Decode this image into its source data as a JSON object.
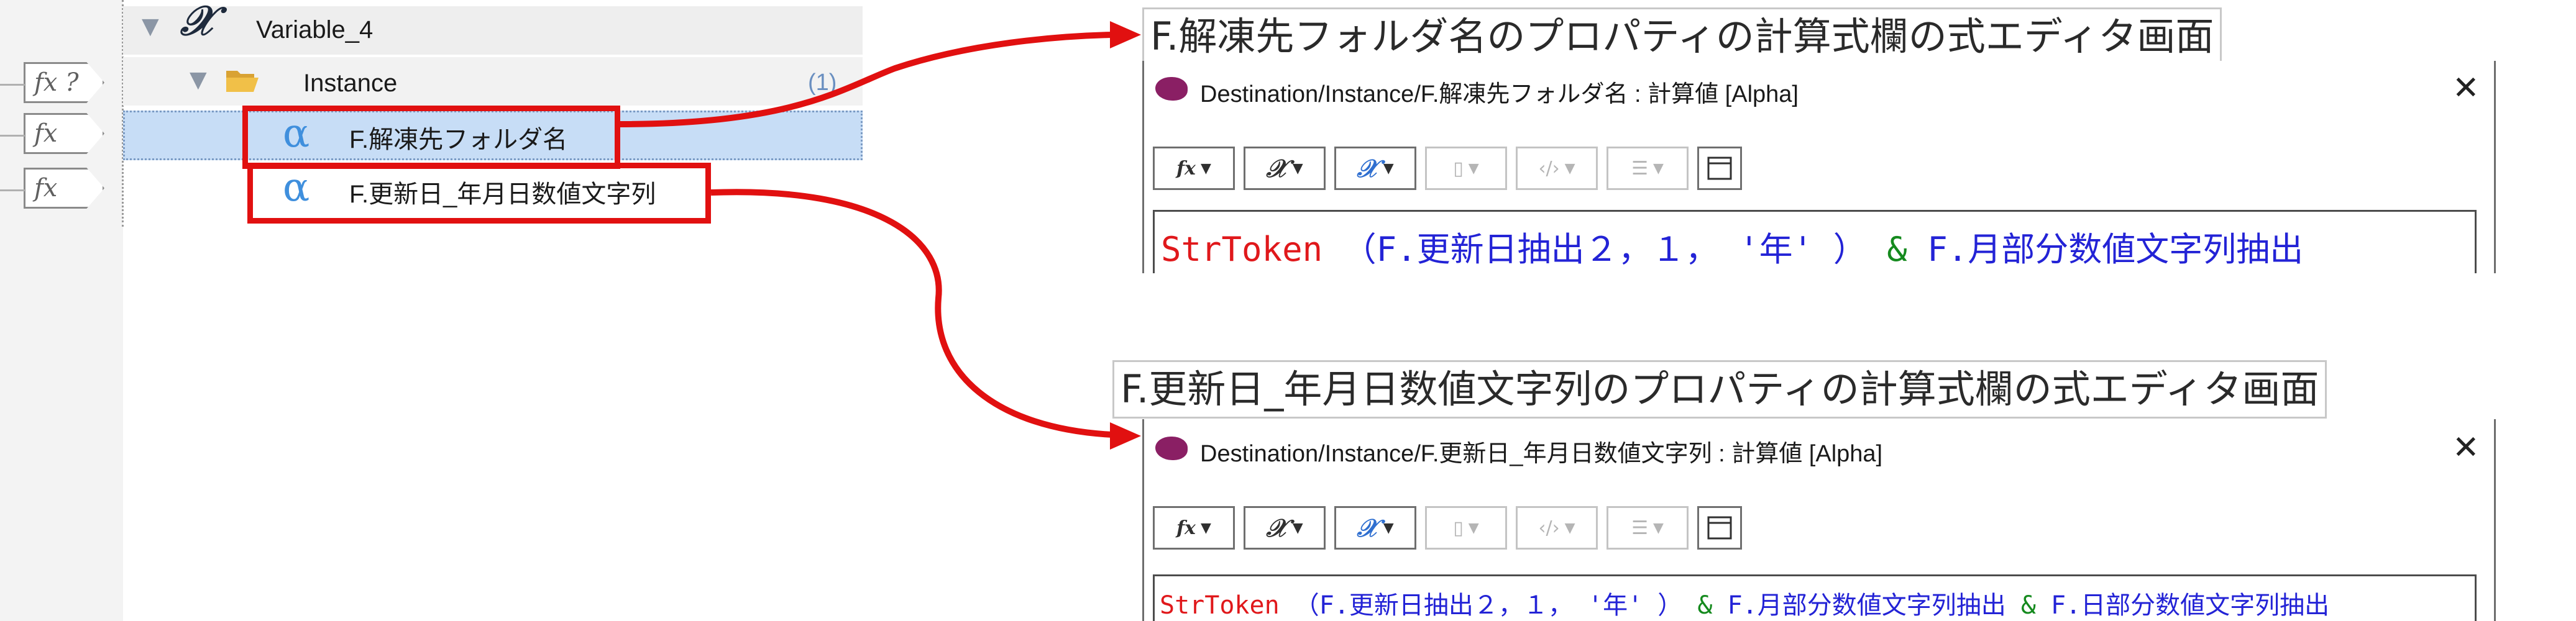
{
  "tree": {
    "fx_tags": [
      {
        "label": "fx ?"
      },
      {
        "label": "fx"
      },
      {
        "label": "fx"
      }
    ],
    "variable": {
      "label": "Variable_4"
    },
    "instance": {
      "label": "Instance",
      "count": "(1)"
    },
    "items": [
      {
        "label": "F.解凍先フォルダ名",
        "selected": true
      },
      {
        "label": "F.更新日_年月日数値文字列",
        "selected": false
      }
    ]
  },
  "captions": {
    "top": "F.解凍先フォルダ名のプロパティの計算式欄の式エディタ画面",
    "bottom": "F.更新日_年月日数値文字列のプロパティの計算式欄の式エディタ画面"
  },
  "editors": [
    {
      "title": "Destination/Instance/F.解凍先フォルダ名 : 計算値 [Alpha]",
      "close": "✕",
      "expression": [
        {
          "text": "StrToken",
          "color": "red"
        },
        {
          "text": "（F.更新日抽出２，１，",
          "color": "blue"
        },
        {
          "text": "'年'",
          "color": "blue"
        },
        {
          "text": "）",
          "color": "blue"
        },
        {
          "text": "&",
          "color": "green"
        },
        {
          "text": "F.月部分数値文字列抽出",
          "color": "blue"
        }
      ]
    },
    {
      "title": "Destination/Instance/F.更新日_年月日数値文字列 : 計算値 [Alpha]",
      "close": "✕",
      "expression": [
        {
          "text": "StrToken",
          "color": "red"
        },
        {
          "text": "（F.更新日抽出２，１，",
          "color": "blue"
        },
        {
          "text": "'年'",
          "color": "blue"
        },
        {
          "text": "）",
          "color": "blue"
        },
        {
          "text": "&",
          "color": "green"
        },
        {
          "text": "F.月部分数値文字列抽出",
          "color": "blue"
        },
        {
          "text": "&",
          "color": "green"
        },
        {
          "text": "F.日部分数値文字列抽出",
          "color": "blue"
        }
      ]
    }
  ],
  "toolbar": [
    {
      "name": "function-button",
      "glyph": "fx",
      "enabled": true
    },
    {
      "name": "variable-button",
      "glyph": "𝒳",
      "enabled": true
    },
    {
      "name": "field-button",
      "glyph": "𝒳ₓ",
      "enabled": true
    },
    {
      "name": "clipboard-button",
      "glyph": "▯",
      "enabled": false
    },
    {
      "name": "code-button",
      "glyph": "‹/›",
      "enabled": false
    },
    {
      "name": "list-button",
      "glyph": "☰",
      "enabled": false
    },
    {
      "name": "panel-button",
      "glyph": "",
      "enabled": true
    }
  ],
  "colors": {
    "highlight": "#e11010",
    "selection": "#c7ddf6",
    "expr_red": "#e0181b",
    "expr_blue": "#2323d6",
    "expr_green": "#158a1e",
    "editor_icon": "#8a1f64"
  }
}
